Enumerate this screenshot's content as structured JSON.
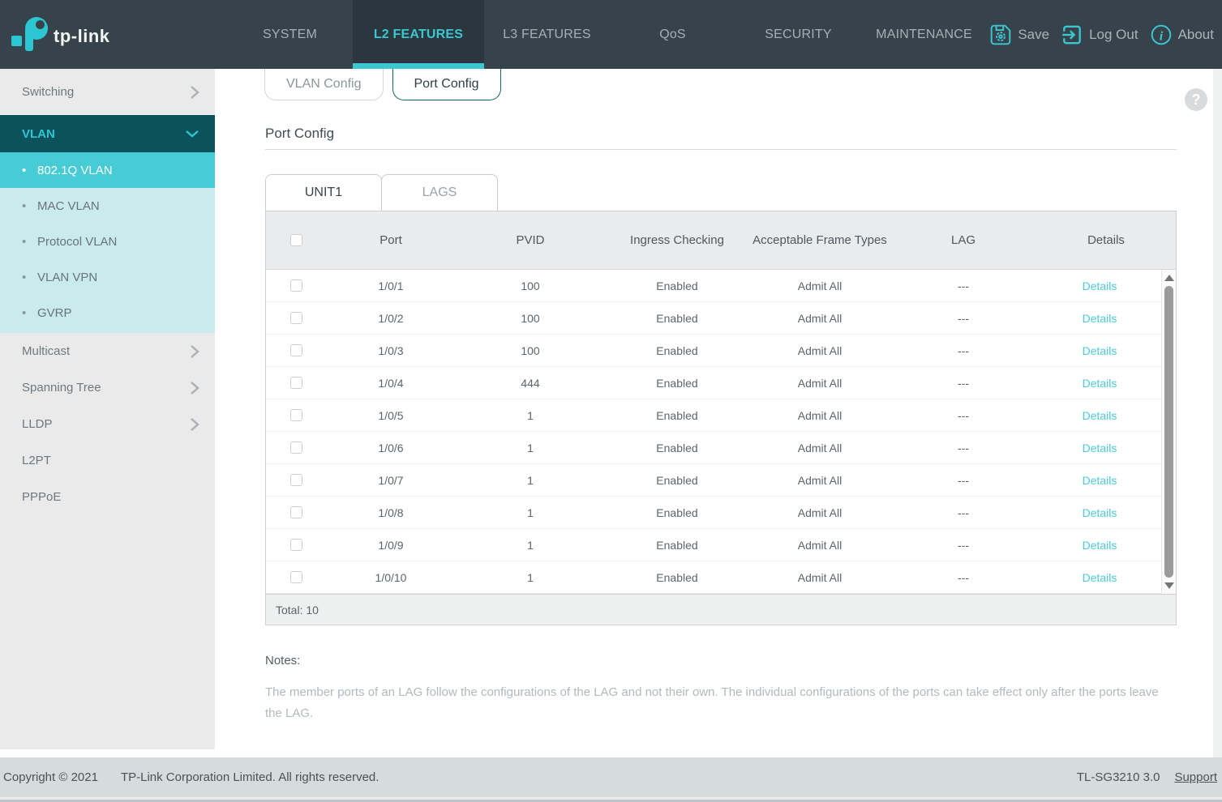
{
  "brand": {
    "logo_text": "tp-link"
  },
  "nav": {
    "items": [
      {
        "label": "SYSTEM",
        "active": false
      },
      {
        "label": "L2 FEATURES",
        "active": true
      },
      {
        "label": "L3 FEATURES",
        "active": false
      },
      {
        "label": "QoS",
        "active": false
      },
      {
        "label": "SECURITY",
        "active": false
      },
      {
        "label": "MAINTENANCE",
        "active": false
      }
    ],
    "actions": [
      {
        "label": "Save",
        "icon": "save-icon"
      },
      {
        "label": "Log Out",
        "icon": "logout-icon"
      },
      {
        "label": "About",
        "icon": "info-icon"
      }
    ]
  },
  "sidebar": {
    "items": [
      {
        "label": "Switching",
        "has_submenu": true
      },
      {
        "label": "VLAN",
        "expanded": true
      },
      {
        "label": "802.1Q VLAN",
        "selected": true
      },
      {
        "label": "MAC VLAN",
        "selected": false
      },
      {
        "label": "Protocol VLAN",
        "selected": false
      },
      {
        "label": "VLAN VPN",
        "selected": false
      },
      {
        "label": "GVRP",
        "selected": false
      },
      {
        "label": "Multicast",
        "has_submenu": true
      },
      {
        "label": "Spanning Tree",
        "has_submenu": true
      },
      {
        "label": "LLDP",
        "has_submenu": true
      },
      {
        "label": "L2PT",
        "has_submenu": false
      },
      {
        "label": "PPPoE",
        "has_submenu": false
      }
    ]
  },
  "content": {
    "page_tabs": [
      {
        "label": "VLAN Config",
        "active": false
      },
      {
        "label": "Port Config",
        "active": true
      }
    ],
    "help_label": "?",
    "title": "Port Config",
    "unit_tabs": [
      {
        "label": "UNIT1",
        "active": true
      },
      {
        "label": "LAGS",
        "active": false
      }
    ],
    "table": {
      "headers": [
        "Port",
        "PVID",
        "Ingress Checking",
        "Acceptable Frame Types",
        "LAG",
        "Details"
      ],
      "rows": [
        {
          "port": "1/0/1",
          "pvid": "100",
          "ingress": "Enabled",
          "frame": "Admit All",
          "lag": "---",
          "details": "Details"
        },
        {
          "port": "1/0/2",
          "pvid": "100",
          "ingress": "Enabled",
          "frame": "Admit All",
          "lag": "---",
          "details": "Details"
        },
        {
          "port": "1/0/3",
          "pvid": "100",
          "ingress": "Enabled",
          "frame": "Admit All",
          "lag": "---",
          "details": "Details"
        },
        {
          "port": "1/0/4",
          "pvid": "444",
          "ingress": "Enabled",
          "frame": "Admit All",
          "lag": "---",
          "details": "Details"
        },
        {
          "port": "1/0/5",
          "pvid": "1",
          "ingress": "Enabled",
          "frame": "Admit All",
          "lag": "---",
          "details": "Details"
        },
        {
          "port": "1/0/6",
          "pvid": "1",
          "ingress": "Enabled",
          "frame": "Admit All",
          "lag": "---",
          "details": "Details"
        },
        {
          "port": "1/0/7",
          "pvid": "1",
          "ingress": "Enabled",
          "frame": "Admit All",
          "lag": "---",
          "details": "Details"
        },
        {
          "port": "1/0/8",
          "pvid": "1",
          "ingress": "Enabled",
          "frame": "Admit All",
          "lag": "---",
          "details": "Details"
        },
        {
          "port": "1/0/9",
          "pvid": "1",
          "ingress": "Enabled",
          "frame": "Admit All",
          "lag": "---",
          "details": "Details"
        },
        {
          "port": "1/0/10",
          "pvid": "1",
          "ingress": "Enabled",
          "frame": "Admit All",
          "lag": "---",
          "details": "Details"
        }
      ],
      "total": "Total: 10"
    },
    "notes": {
      "title": "Notes:",
      "body": "The member ports of an LAG follow the configurations of the LAG and not their own. The individual configurations of the ports can take effect only after the ports leave the LAG."
    }
  },
  "footer": {
    "copyright": "Copyright © 2021",
    "company": "TP-Link Corporation Limited. All rights reserved.",
    "model": "TL-SG3210 3.0",
    "support": "Support"
  },
  "colors": {
    "accent_cyan": "#3bc7d2",
    "nav_bg": "#37434b",
    "nav_active_bg": "#2b373e",
    "vlan_group_bg": "#0c525c",
    "selected_item_bg": "#47ccd5",
    "submenu_bg": "#c9ebee",
    "table_header_bg": "#e9ebec",
    "details_link": "#4ec9d6",
    "footer_bg": "#d6dbdb"
  }
}
